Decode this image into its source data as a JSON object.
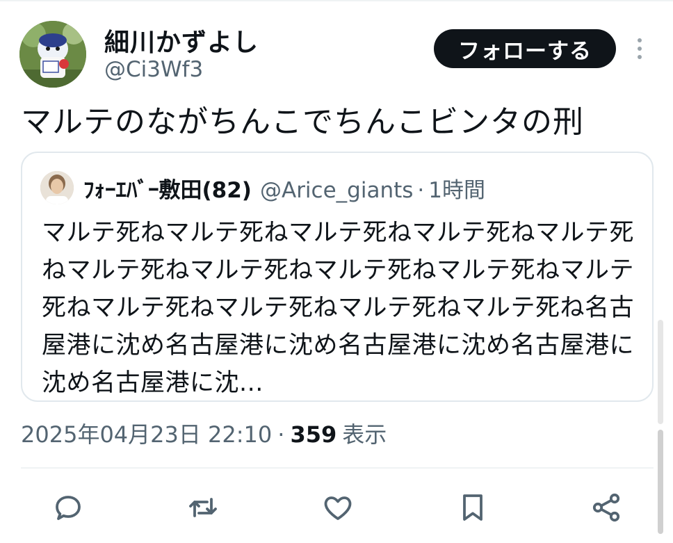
{
  "author": {
    "display_name": "細川かずよし",
    "handle": "@Ci3Wf3",
    "avatar_icon": "mascot-avatar"
  },
  "follow_button": {
    "label": "フォローする"
  },
  "more_icon": "more-vertical-icon",
  "tweet": {
    "text": "マルテのながちんこでちんこビンタの刑"
  },
  "quote": {
    "author_name": "ﾌｫｰｴﾊﾞｰ敷田(82)",
    "author_handle": "@Arice_giants",
    "separator": "·",
    "time": "1時間",
    "text": "マルテ死ねマルテ死ねマルテ死ねマルテ死ねマルテ死ねマルテ死ねマルテ死ねマルテ死ねマルテ死ねマルテ死ねマルテ死ねマルテ死ねマルテ死ねマルテ死ね名古屋港に沈め名古屋港に沈め名古屋港に沈め名古屋港に沈め名古屋港に沈..."
  },
  "meta": {
    "timestamp": "2025年04月23日 22:10",
    "separator": "·",
    "views_count": "359",
    "views_label": "表示"
  },
  "actions": [
    {
      "name": "reply",
      "icon": "reply-icon"
    },
    {
      "name": "repost",
      "icon": "repost-icon"
    },
    {
      "name": "like",
      "icon": "heart-icon"
    },
    {
      "name": "bookmark",
      "icon": "bookmark-icon"
    },
    {
      "name": "share",
      "icon": "share-icon"
    }
  ],
  "colors": {
    "text_primary": "#0f1419",
    "text_secondary": "#536471",
    "border": "#e1e8ed",
    "button_bg": "#0f1419"
  }
}
